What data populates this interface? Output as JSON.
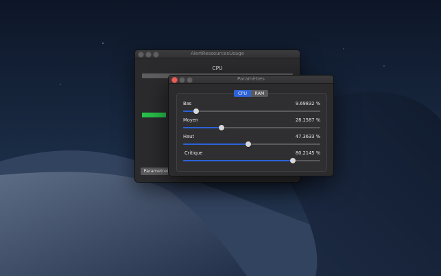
{
  "back_window": {
    "title": "AlertRessourcesUsage",
    "cpu_label": "CPU",
    "cpu_level": 0.16,
    "params_button": "Parametres"
  },
  "settings_window": {
    "title": "Paramètres",
    "tabs": [
      {
        "label": "CPU",
        "selected": true
      },
      {
        "label": "RAM",
        "selected": false
      }
    ],
    "sliders": [
      {
        "label": "Bas",
        "value_text": "9.69832 %",
        "value": 9.69832
      },
      {
        "label": "Moyen",
        "value_text": "28.1587 %",
        "value": 28.1587
      },
      {
        "label": "Haut",
        "value_text": "47.3633 %",
        "value": 47.3633
      },
      {
        "label": "Critique",
        "value_text": "80.2145 %",
        "value": 80.2145
      }
    ]
  },
  "colors": {
    "accent": "#2a62d8",
    "cpu_bar": "#27c14b",
    "close_button": "#ec5f57"
  }
}
